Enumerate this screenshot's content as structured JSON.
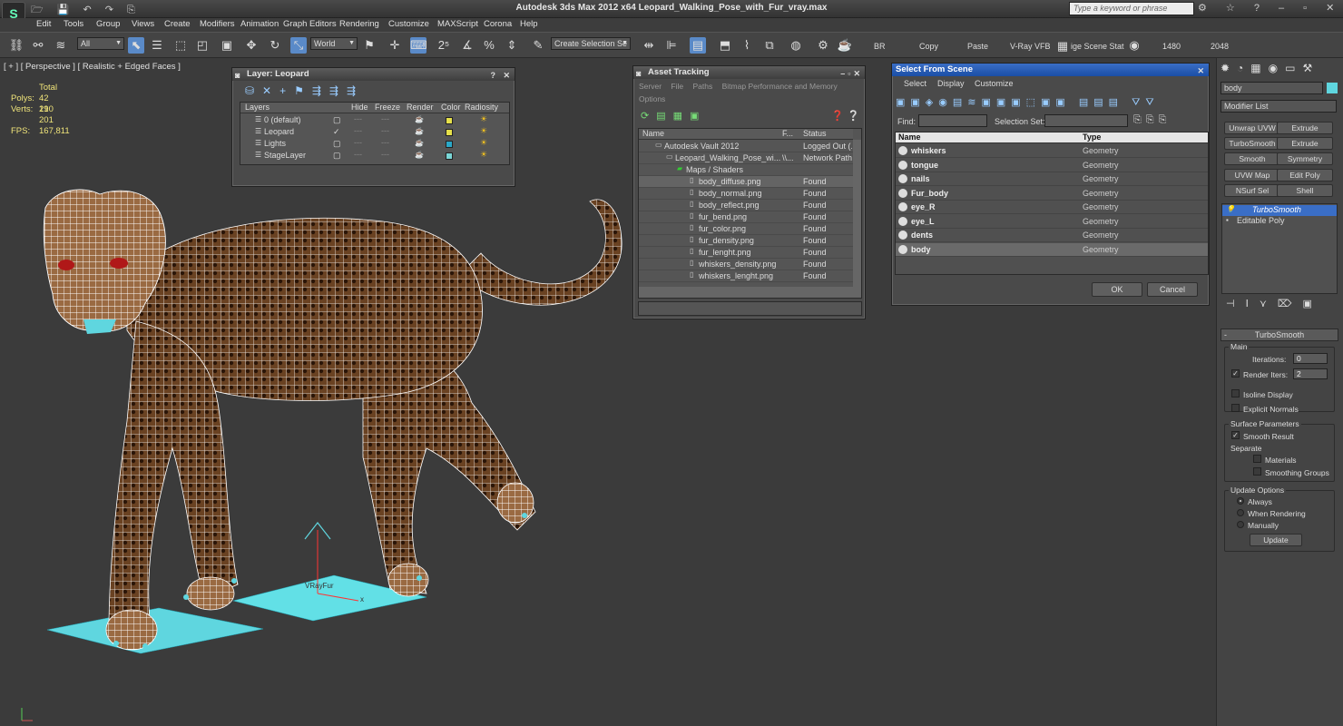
{
  "app": {
    "logo": "S",
    "title": "Autodesk 3ds Max  2012 x64     Leopard_Walking_Pose_with_Fur_vray.max",
    "search_placeholder": "Type a keyword or phrase"
  },
  "menu": [
    "Edit",
    "Tools",
    "Group",
    "Views",
    "Create",
    "Modifiers",
    "Animation",
    "Graph Editors",
    "Rendering",
    "Customize",
    "MAXScript",
    "Corona",
    "Help"
  ],
  "toolbar": {
    "selection_filter": "All",
    "ref_coord": "World",
    "named_selection": "Create Selection Se",
    "texts": [
      "BR",
      "Copy",
      "Paste",
      "V-Ray VFB",
      "ige Scene Stat",
      "1480",
      "2048"
    ]
  },
  "viewport": {
    "label": "[ + ] [ Perspective ] [ Realistic + Edged Faces ]",
    "stats": {
      "total_label": "Total",
      "polys_label": "Polys:",
      "polys": "42 190",
      "verts_label": "Verts:",
      "verts": "21 201",
      "fps_label": "FPS:",
      "fps": "167,811"
    },
    "vrayfur_label": "VRayFur",
    "gizmo_x": "x"
  },
  "layer_window": {
    "title": "Layer: Leopard",
    "columns": [
      "Layers",
      "Hide",
      "Freeze",
      "Render",
      "Color",
      "Radiosity"
    ],
    "rows": [
      {
        "name": "0 (default)",
        "active": false,
        "color": "#e6e04a"
      },
      {
        "name": "Leopard",
        "active": true,
        "color": "#e6e04a"
      },
      {
        "name": "Lights",
        "active": false,
        "color": "#2aa8c8"
      },
      {
        "name": "StageLayer",
        "active": false,
        "color": "#7ad6d6"
      }
    ]
  },
  "asset_window": {
    "title": "Asset Tracking",
    "menu": [
      "Server",
      "File",
      "Paths",
      "Bitmap Performance and Memory"
    ],
    "menu2": "Options",
    "columns": [
      "Name",
      "F...",
      "Status"
    ],
    "rows": [
      {
        "name": "Autodesk Vault 2012",
        "f": "",
        "status": "Logged Out (..."
      },
      {
        "name": "Leopard_Walking_Pose_wi...",
        "f": "\\\\...",
        "status": "Network Path"
      },
      {
        "name": "Maps / Shaders",
        "f": "",
        "status": ""
      },
      {
        "name": "body_diffuse.png",
        "f": "",
        "status": "Found"
      },
      {
        "name": "body_normal.png",
        "f": "",
        "status": "Found"
      },
      {
        "name": "body_reflect.png",
        "f": "",
        "status": "Found"
      },
      {
        "name": "fur_bend.png",
        "f": "",
        "status": "Found"
      },
      {
        "name": "fur_color.png",
        "f": "",
        "status": "Found"
      },
      {
        "name": "fur_density.png",
        "f": "",
        "status": "Found"
      },
      {
        "name": "fur_lenght.png",
        "f": "",
        "status": "Found"
      },
      {
        "name": "whiskers_density.png",
        "f": "",
        "status": "Found"
      },
      {
        "name": "whiskers_lenght.png",
        "f": "",
        "status": "Found"
      }
    ]
  },
  "select_window": {
    "title": "Select From Scene",
    "menu": [
      "Select",
      "Display",
      "Customize"
    ],
    "find_label": "Find:",
    "selset_label": "Selection Set:",
    "columns": [
      "Name",
      "Type"
    ],
    "rows": [
      {
        "name": "whiskers",
        "type": "Geometry"
      },
      {
        "name": "tongue",
        "type": "Geometry"
      },
      {
        "name": "nails",
        "type": "Geometry"
      },
      {
        "name": "Fur_body",
        "type": "Geometry"
      },
      {
        "name": "eye_R",
        "type": "Geometry"
      },
      {
        "name": "eye_L",
        "type": "Geometry"
      },
      {
        "name": "dents",
        "type": "Geometry"
      },
      {
        "name": "body",
        "type": "Geometry"
      }
    ],
    "ok": "OK",
    "cancel": "Cancel"
  },
  "command_panel": {
    "object_name": "body",
    "modifier_list": "Modifier List",
    "buttons": [
      "Unwrap UVW",
      "Extrude",
      "TurboSmooth",
      "Extrude",
      "Smooth",
      "Symmetry",
      "UVW Map",
      "Edit Poly",
      "NSurf Sel",
      "Shell"
    ],
    "stack": [
      "TurboSmooth",
      "Editable Poly"
    ],
    "rollout_title": "TurboSmooth",
    "main_label": "Main",
    "iterations_label": "Iterations:",
    "iterations": "0",
    "render_iters_label": "Render Iters:",
    "render_iters": "2",
    "isoline": "Isoline Display",
    "explicit": "Explicit Normals",
    "surface_label": "Surface Parameters",
    "smooth_result": "Smooth Result",
    "separate": "Separate",
    "materials": "Materials",
    "smoothing_groups": "Smoothing Groups",
    "update_options": "Update Options",
    "always": "Always",
    "when_rendering": "When Rendering",
    "manually": "Manually",
    "update": "Update"
  }
}
